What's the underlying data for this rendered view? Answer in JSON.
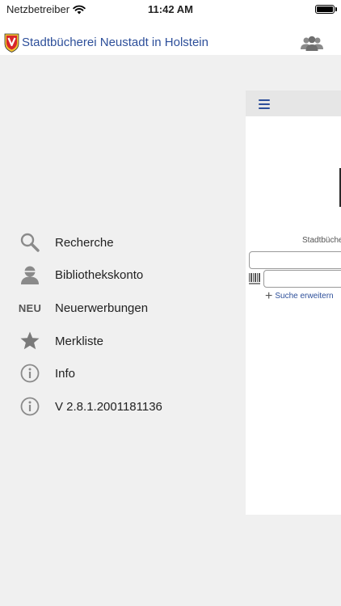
{
  "status_bar": {
    "carrier": "Netzbetreiber",
    "time": "11:42 AM"
  },
  "header": {
    "title": "Stadtbücherei Neustadt in Holstein",
    "crest_icon": "town-crest-icon",
    "account_icon": "users-icon"
  },
  "menu": {
    "items": [
      {
        "label": "Recherche",
        "icon": "search-icon"
      },
      {
        "label": "Bibliothekskonto",
        "icon": "user-icon"
      },
      {
        "label": "Neuerwerbungen",
        "icon": "neu-icon",
        "icon_text": "NEU"
      },
      {
        "label": "Merkliste",
        "icon": "star-icon"
      },
      {
        "label": "Info",
        "icon": "info-icon"
      },
      {
        "label": "V 2.8.1.2001181136",
        "icon": "info-icon"
      }
    ]
  },
  "panel": {
    "library_name": "Stadtbüche",
    "extend_search": "Suche erweitern",
    "menu_icon": "hamburger-menu-icon"
  },
  "colors": {
    "accent": "#2d4f9a",
    "background": "#f0f0f0"
  }
}
